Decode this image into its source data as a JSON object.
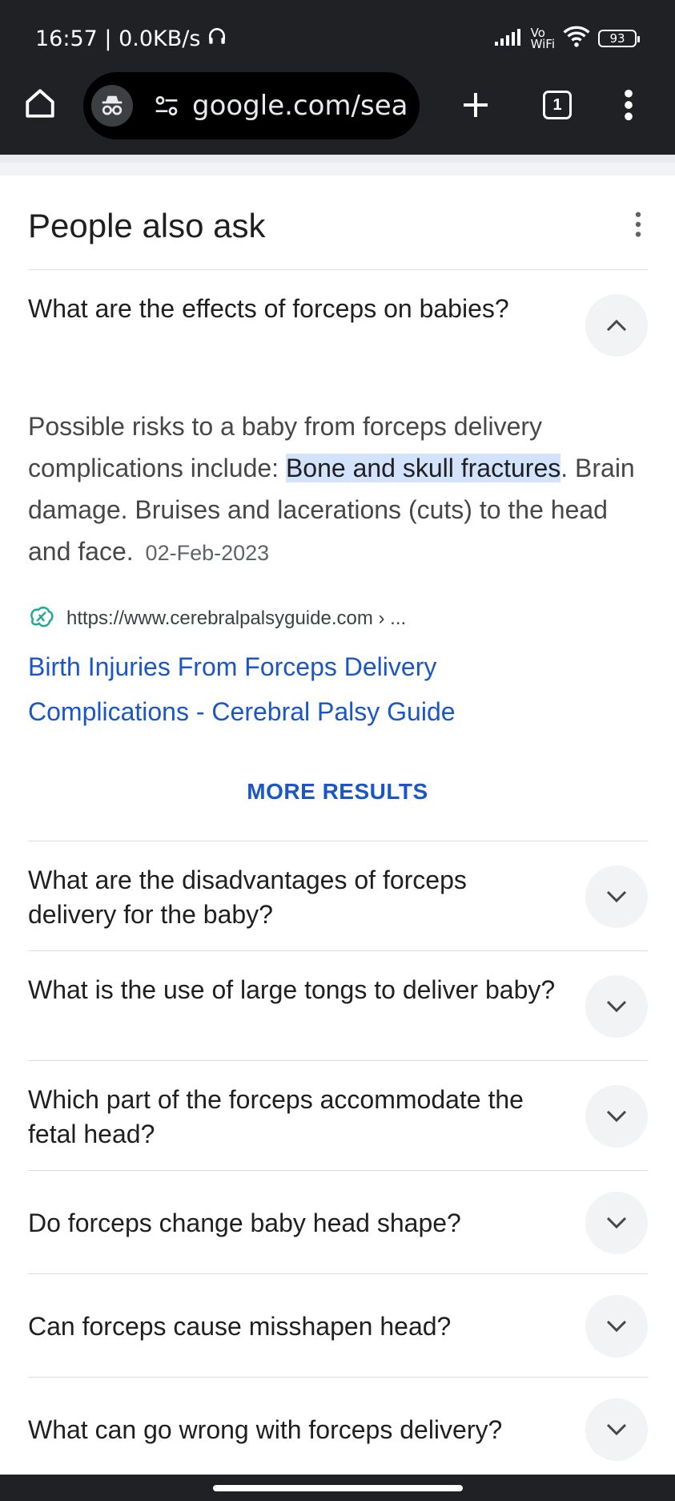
{
  "status_bar": {
    "time": "16:57 | 0.0KB/s",
    "network": [
      "Vo",
      "WiFi"
    ],
    "battery": "93"
  },
  "browser": {
    "url": "google.com/search",
    "tab_count": "1"
  },
  "paa": {
    "title": "People also ask",
    "expanded": {
      "question": "What are the effects of forceps on babies?",
      "answer_before": "Possible risks to a baby from forceps delivery complications include: ",
      "answer_highlight": "Bone and skull fractures",
      "answer_after": ". Brain damage. Bruises and lacerations (cuts) to the head and face.",
      "date": "02-Feb-2023",
      "source_url": "https://www.cerebralpalsyguide.com › ...",
      "link_title": "Birth Injuries From Forceps Delivery Complications - Cerebral Palsy Guide",
      "more_results": "MORE RESULTS"
    },
    "questions": [
      "What are the disadvantages of forceps delivery for the baby?",
      "What is the use of large tongs to deliver baby?",
      "Which part of the forceps accommodate the fetal head?",
      "Do forceps change baby head shape?",
      "Can forceps cause misshapen head?",
      "What can go wrong with forceps delivery?"
    ]
  },
  "icons": {
    "home": "home-icon",
    "incognito": "incognito-icon",
    "site_settings": "tune-icon",
    "new_tab": "plus-icon",
    "menu": "more-vert-icon",
    "chevron_up": "chevron-up-icon",
    "chevron_down": "chevron-down-icon",
    "favicon": "cerebral-palsy-guide-favicon"
  },
  "colors": {
    "link": "#1a56c6",
    "highlight": "#d3e3fd",
    "chrome_dark": "#202124"
  }
}
